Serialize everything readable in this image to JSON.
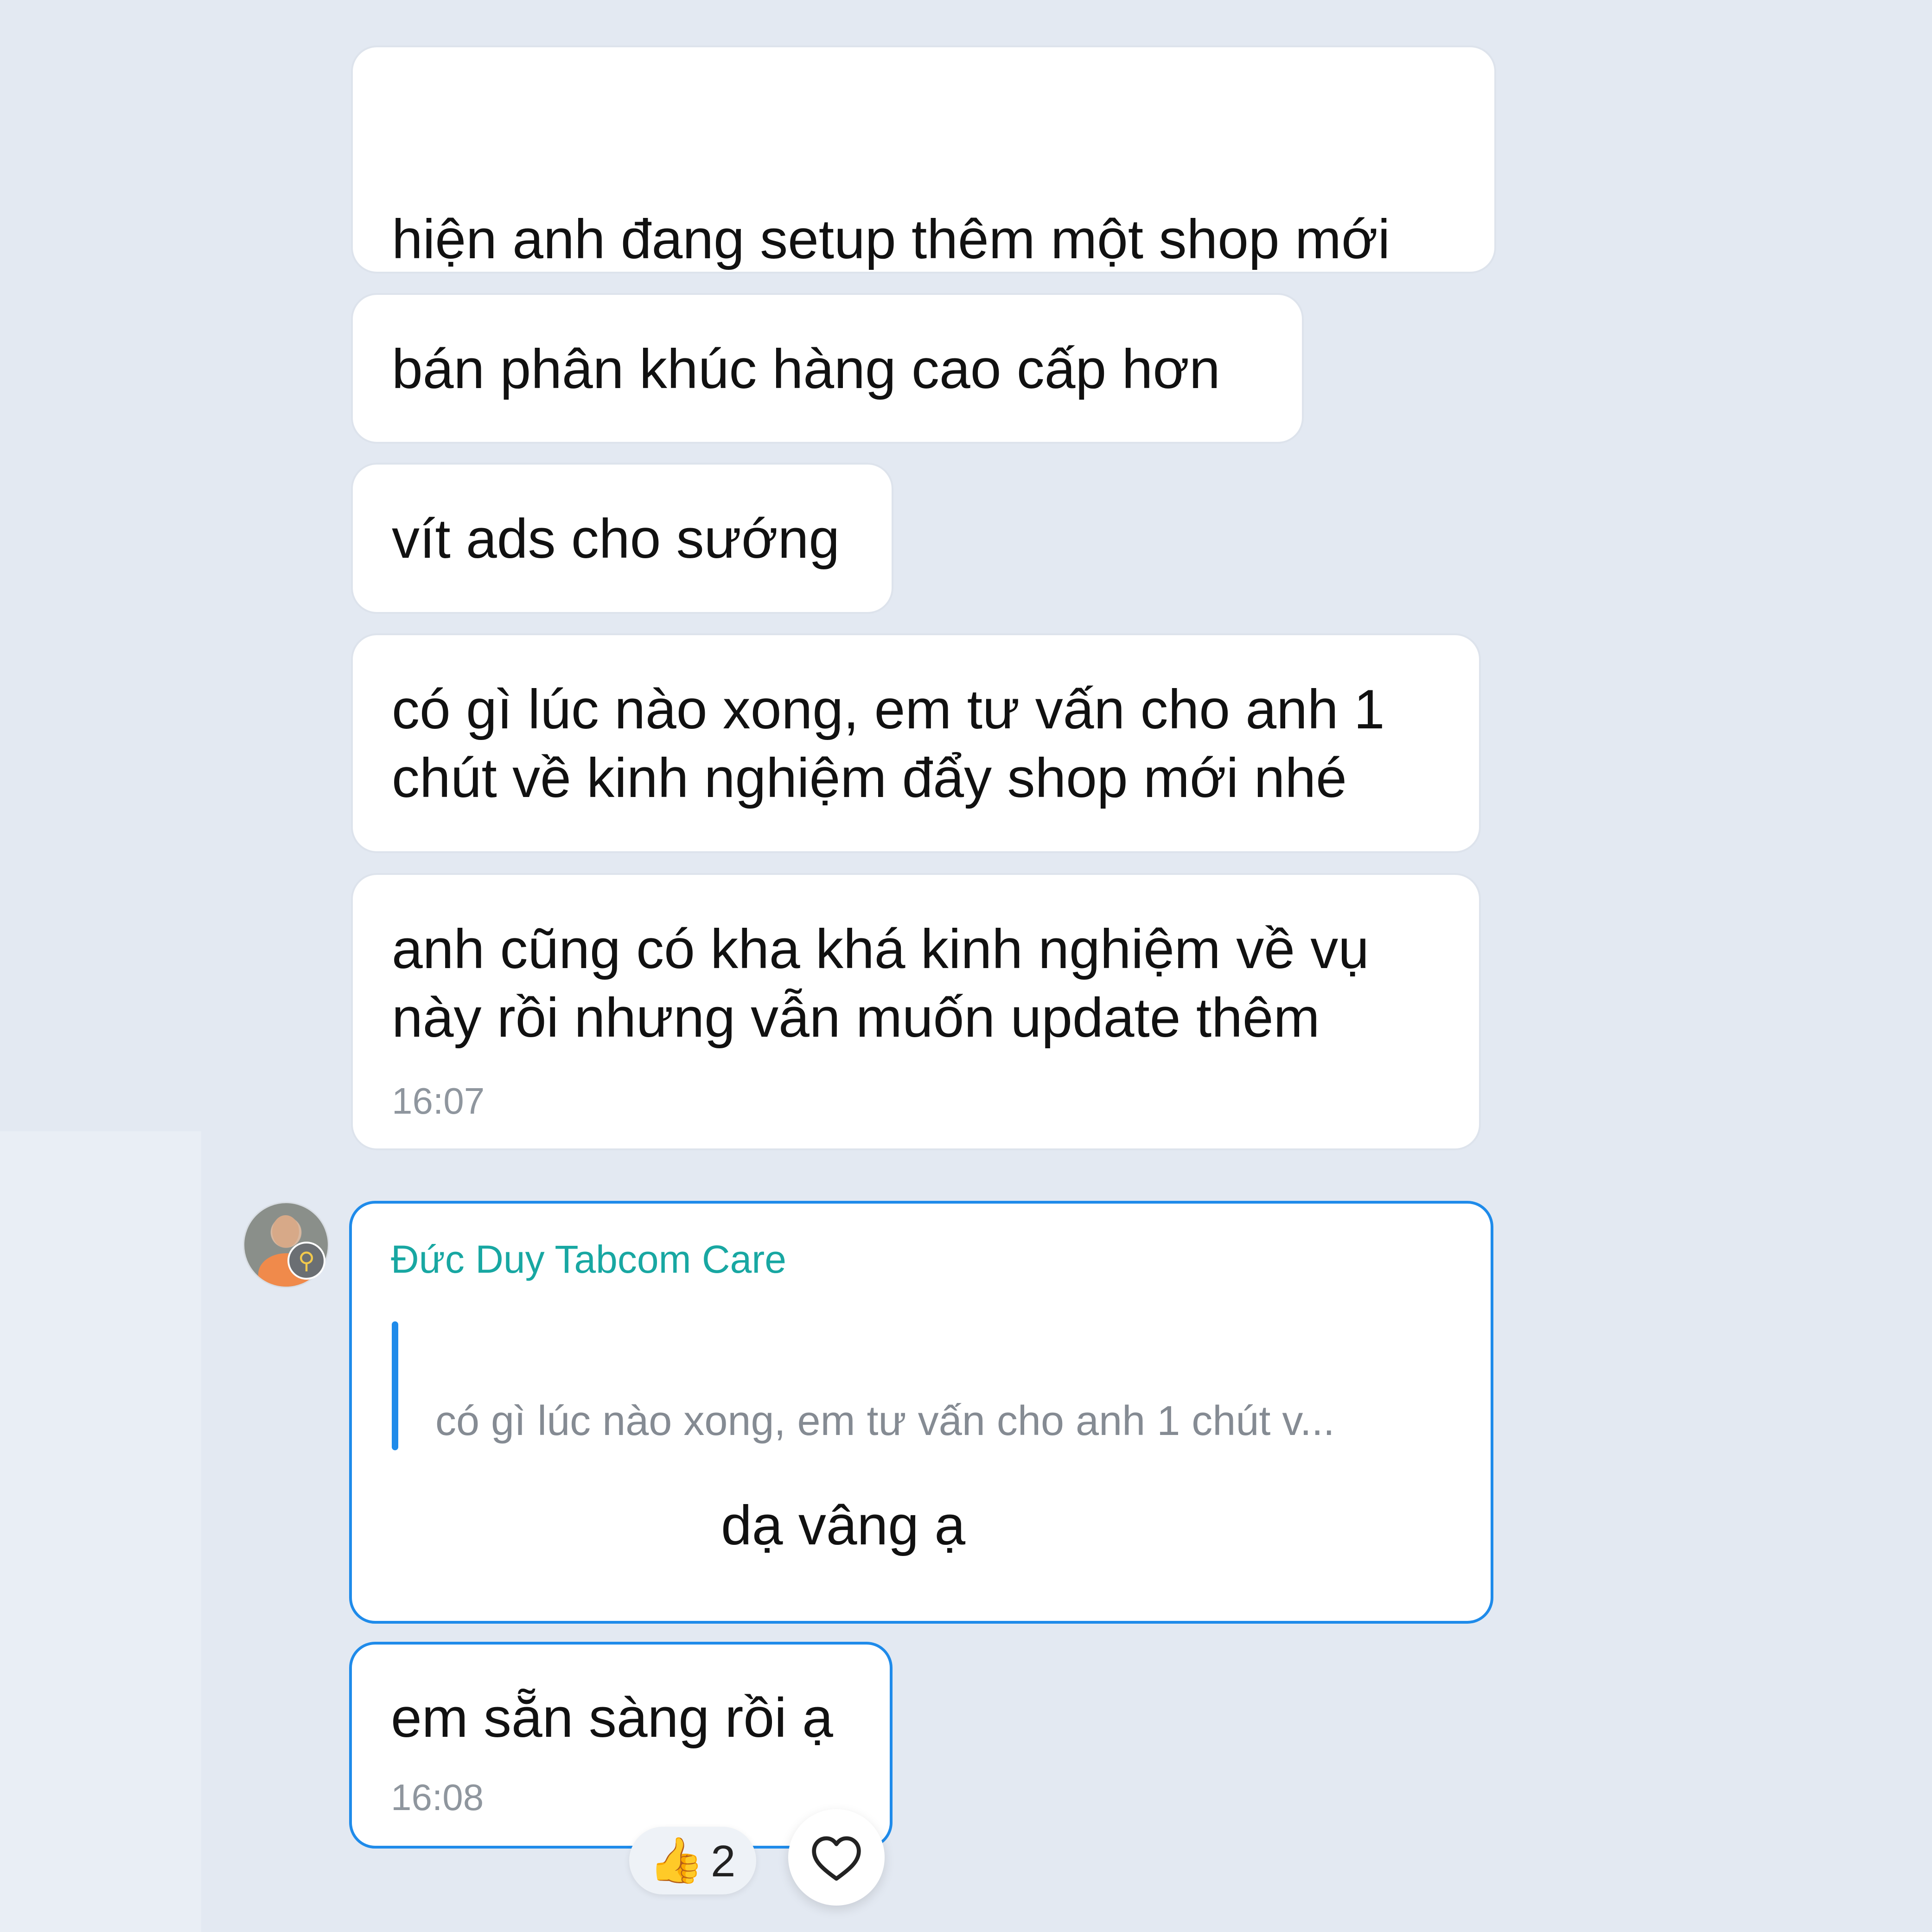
{
  "messages": [
    {
      "text": "hiện anh đang setup thêm một shop mới"
    },
    {
      "text": "bán phân khúc hàng cao cấp hơn"
    },
    {
      "text": "vít ads cho sướng"
    },
    {
      "text_line1": "có gì lúc nào xong, em tư vấn cho anh 1",
      "text_line2": "chút về kinh nghiệm đẩy shop mới nhé"
    },
    {
      "text_line1": "anh cũng có kha khá kinh nghiệm về vụ",
      "text_line2": "này rồi nhưng vẫn muốn update thêm",
      "time": "16:07"
    }
  ],
  "reply": {
    "sender": "Đức Duy Tabcom Care",
    "quote": "có gì lúc nào xong, em tư vấn cho anh 1 chút v...",
    "text": "dạ vâng ạ"
  },
  "last_message": {
    "text": "em sẵn sàng rồi ạ",
    "time": "16:08"
  },
  "reaction": {
    "emoji": "👍",
    "count": "2"
  },
  "icons": {
    "heart": "heart-icon",
    "badge": "key-icon"
  },
  "colors": {
    "background": "#e3e9f2",
    "bubble": "#ffffff",
    "accent_blue": "#1f8bea",
    "sender_teal": "#18a7a2",
    "timestamp": "#8f969e"
  }
}
